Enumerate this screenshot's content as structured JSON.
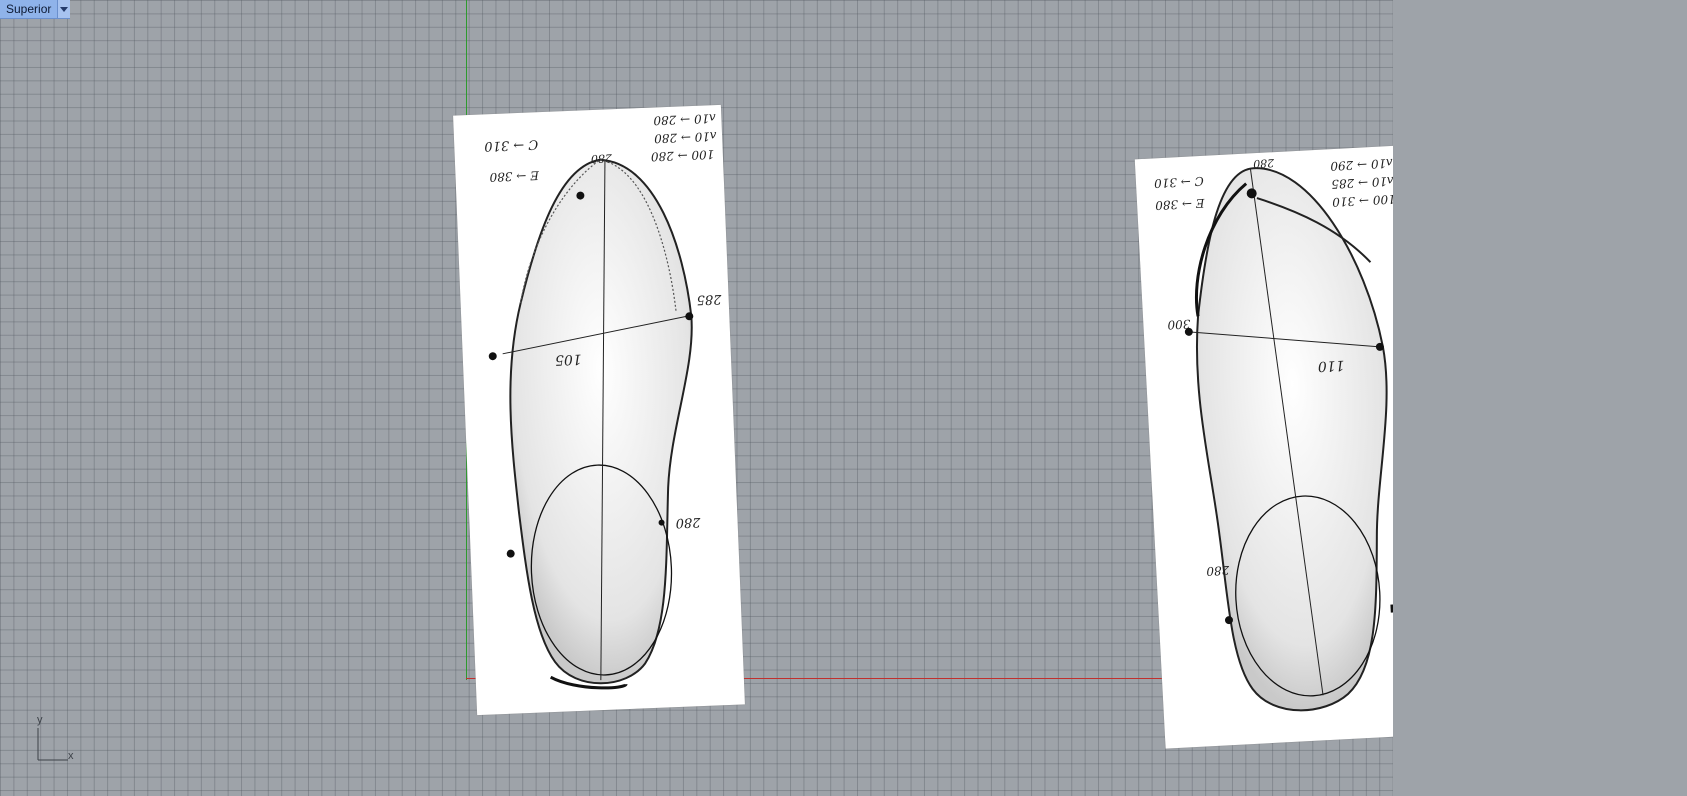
{
  "viewport": {
    "name": "Superior",
    "background": "#9ea3a9",
    "x_axis_color": "#c0302e",
    "y_axis_color": "#2e9a2e"
  },
  "left_sheet": {
    "notes": [
      "ʌ10 → 280",
      "ʌ10 → 280",
      "100 → 280",
      "C → 310",
      "E → 380"
    ],
    "measure_width": "105",
    "measure_side": "285",
    "measure_heel": "280",
    "toe_mark": "280"
  },
  "right_sheet": {
    "notes": [
      "ʌ10 → 290",
      "ʌ10 → 285",
      "100 → 310",
      "C → 310",
      "E → 380"
    ],
    "measure_width": "110",
    "measure_side": "300",
    "measure_heel": "280",
    "toe_mark": "280"
  },
  "gizmo": {
    "y_label": "y",
    "x_label": "x"
  }
}
